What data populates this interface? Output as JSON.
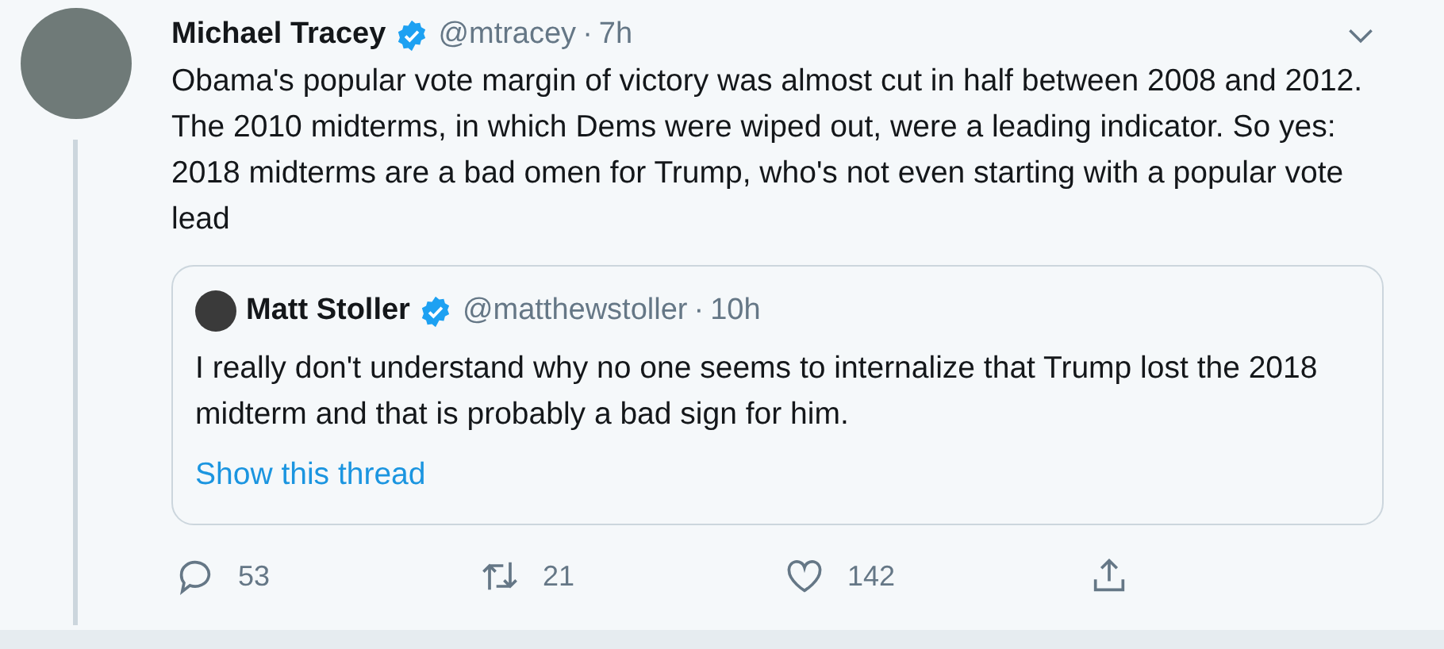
{
  "tweet": {
    "name": "Michael Tracey",
    "verified": true,
    "handle": "@mtracey",
    "separator": "·",
    "time": "7h",
    "text": "Obama's popular vote margin of victory was almost cut in half between 2008 and 2012. The 2010 midterms, in which Dems were wiped out, were a leading indicator. So yes: 2018 midterms are a bad omen for Trump, who's not even starting with a popular vote lead",
    "quote": {
      "name": "Matt Stoller",
      "verified": true,
      "handle": "@matthewstoller",
      "separator": "·",
      "time": "10h",
      "text": "I really don't understand why no one seems to internalize that Trump lost the 2018 midterm and that is probably a bad sign for him.",
      "link": "Show this thread"
    },
    "actions": [
      {
        "kind": "reply",
        "count": "53"
      },
      {
        "kind": "retweet",
        "count": "21"
      },
      {
        "kind": "like",
        "count": "142"
      },
      {
        "kind": "share"
      }
    ]
  }
}
